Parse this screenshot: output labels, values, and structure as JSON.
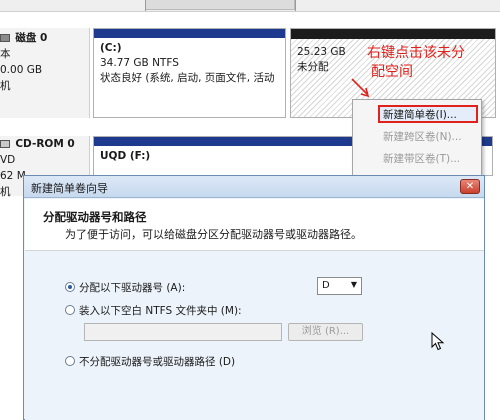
{
  "disks": [
    {
      "label_lines": [
        "磁盘 0",
        "本",
        "0.00 GB",
        "机"
      ],
      "partitions": [
        {
          "name": "(C:)",
          "size": "34.77 GB NTFS",
          "status": "状态良好 (系统, 启动, 页面文件, 活动"
        }
      ],
      "unallocated": {
        "size": "25.23 GB",
        "status": "未分配"
      }
    },
    {
      "label_lines": [
        "CD-ROM 0",
        "VD",
        "62 M",
        "机"
      ],
      "partitions": [
        {
          "name": "UQD  (F:)"
        }
      ]
    }
  ],
  "annotation": {
    "line1": "右键点击该未分",
    "line2": "配空间"
  },
  "context_menu": {
    "items": [
      "新建简单卷(I)...",
      "新建跨区卷(N)...",
      "新建带区卷(T)..."
    ]
  },
  "wizard": {
    "title": "新建简单卷向导",
    "header_title": "分配驱动器号和路径",
    "header_subtitle": "为了便于访问，可以给磁盘分区分配驱动器号或驱动器路径。",
    "option_assign_letter": "分配以下驱动器号 (A):",
    "drive_letter": "D",
    "option_mount_folder": "装入以下空白 NTFS 文件夹中 (M):",
    "folder_path": "",
    "browse_label": "浏览 (R)...",
    "option_no_letter": "不分配驱动器号或驱动器路径 (D)"
  },
  "colors": {
    "partition_bar": "#1e3a8f",
    "unallocated_bar": "#1c1c1c",
    "annotation": "#e0211c",
    "dialog_background": "#ecf3fb"
  }
}
